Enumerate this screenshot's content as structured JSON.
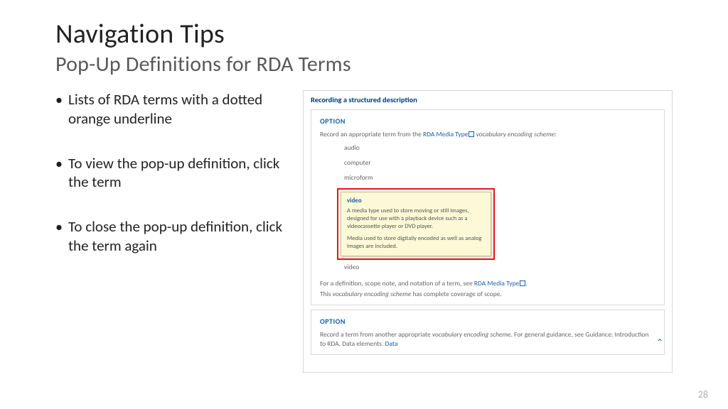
{
  "title": "Navigation Tips",
  "subtitle": "Pop-Up Definitions for RDA Terms",
  "bullets": [
    "Lists of RDA terms with a dotted orange underline",
    "To view the pop-up definition, click the term",
    "To close the pop-up definition, click the term again"
  ],
  "screenshot": {
    "section_title": "Recording a structured description",
    "option1": {
      "label": "OPTION",
      "intro_pre": "Record an appropriate term from the ",
      "intro_link": "RDA Media Type",
      "intro_post": " vocabulary encoding scheme:",
      "terms": [
        "audio",
        "computer",
        "microform"
      ],
      "popup": {
        "term": "video",
        "para1": "A media type used to store moving or still images, designed for use with a playback device such as a videocassette player or DVD player.",
        "para2": "Media used to store digitally encoded as well as analog images are included."
      },
      "term_after": "video",
      "footer1_pre": "For a definition, scope note, and notation of a term, see ",
      "footer1_link": "RDA Media Type",
      "footer2_pre": "This ",
      "footer2_italic": "vocabulary encoding scheme",
      "footer2_post": " has complete coverage of scope."
    },
    "option2": {
      "label": "OPTION",
      "text_pre": "Record a term from another appropriate ",
      "text_italic": "vocabulary encoding scheme",
      "text_mid": ". For general guidance, see Guidance: Introduction to RDA, Data elements. ",
      "text_link": "Data"
    }
  },
  "page_number": "28"
}
